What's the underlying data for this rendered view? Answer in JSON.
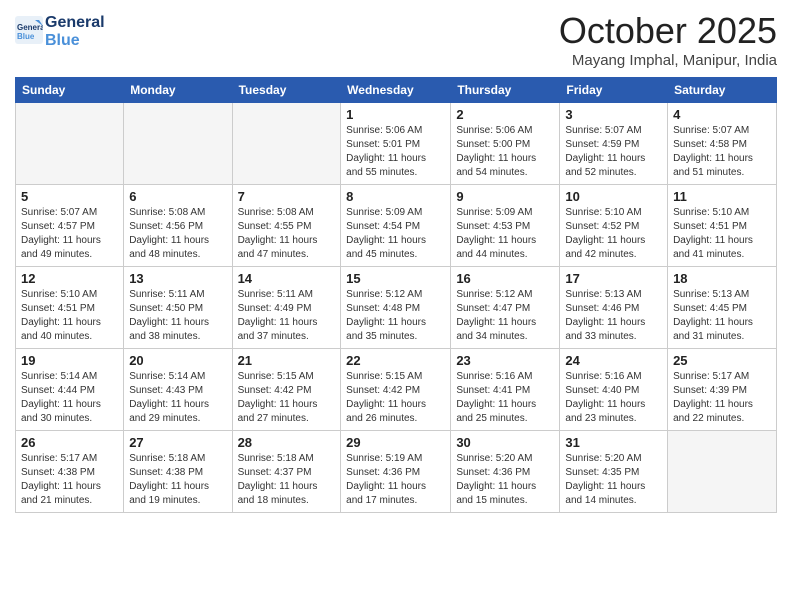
{
  "logo": {
    "line1": "General",
    "line2": "Blue"
  },
  "title": "October 2025",
  "location": "Mayang Imphal, Manipur, India",
  "weekdays": [
    "Sunday",
    "Monday",
    "Tuesday",
    "Wednesday",
    "Thursday",
    "Friday",
    "Saturday"
  ],
  "weeks": [
    [
      {
        "day": "",
        "info": ""
      },
      {
        "day": "",
        "info": ""
      },
      {
        "day": "",
        "info": ""
      },
      {
        "day": "1",
        "info": "Sunrise: 5:06 AM\nSunset: 5:01 PM\nDaylight: 11 hours\nand 55 minutes."
      },
      {
        "day": "2",
        "info": "Sunrise: 5:06 AM\nSunset: 5:00 PM\nDaylight: 11 hours\nand 54 minutes."
      },
      {
        "day": "3",
        "info": "Sunrise: 5:07 AM\nSunset: 4:59 PM\nDaylight: 11 hours\nand 52 minutes."
      },
      {
        "day": "4",
        "info": "Sunrise: 5:07 AM\nSunset: 4:58 PM\nDaylight: 11 hours\nand 51 minutes."
      }
    ],
    [
      {
        "day": "5",
        "info": "Sunrise: 5:07 AM\nSunset: 4:57 PM\nDaylight: 11 hours\nand 49 minutes."
      },
      {
        "day": "6",
        "info": "Sunrise: 5:08 AM\nSunset: 4:56 PM\nDaylight: 11 hours\nand 48 minutes."
      },
      {
        "day": "7",
        "info": "Sunrise: 5:08 AM\nSunset: 4:55 PM\nDaylight: 11 hours\nand 47 minutes."
      },
      {
        "day": "8",
        "info": "Sunrise: 5:09 AM\nSunset: 4:54 PM\nDaylight: 11 hours\nand 45 minutes."
      },
      {
        "day": "9",
        "info": "Sunrise: 5:09 AM\nSunset: 4:53 PM\nDaylight: 11 hours\nand 44 minutes."
      },
      {
        "day": "10",
        "info": "Sunrise: 5:10 AM\nSunset: 4:52 PM\nDaylight: 11 hours\nand 42 minutes."
      },
      {
        "day": "11",
        "info": "Sunrise: 5:10 AM\nSunset: 4:51 PM\nDaylight: 11 hours\nand 41 minutes."
      }
    ],
    [
      {
        "day": "12",
        "info": "Sunrise: 5:10 AM\nSunset: 4:51 PM\nDaylight: 11 hours\nand 40 minutes."
      },
      {
        "day": "13",
        "info": "Sunrise: 5:11 AM\nSunset: 4:50 PM\nDaylight: 11 hours\nand 38 minutes."
      },
      {
        "day": "14",
        "info": "Sunrise: 5:11 AM\nSunset: 4:49 PM\nDaylight: 11 hours\nand 37 minutes."
      },
      {
        "day": "15",
        "info": "Sunrise: 5:12 AM\nSunset: 4:48 PM\nDaylight: 11 hours\nand 35 minutes."
      },
      {
        "day": "16",
        "info": "Sunrise: 5:12 AM\nSunset: 4:47 PM\nDaylight: 11 hours\nand 34 minutes."
      },
      {
        "day": "17",
        "info": "Sunrise: 5:13 AM\nSunset: 4:46 PM\nDaylight: 11 hours\nand 33 minutes."
      },
      {
        "day": "18",
        "info": "Sunrise: 5:13 AM\nSunset: 4:45 PM\nDaylight: 11 hours\nand 31 minutes."
      }
    ],
    [
      {
        "day": "19",
        "info": "Sunrise: 5:14 AM\nSunset: 4:44 PM\nDaylight: 11 hours\nand 30 minutes."
      },
      {
        "day": "20",
        "info": "Sunrise: 5:14 AM\nSunset: 4:43 PM\nDaylight: 11 hours\nand 29 minutes."
      },
      {
        "day": "21",
        "info": "Sunrise: 5:15 AM\nSunset: 4:42 PM\nDaylight: 11 hours\nand 27 minutes."
      },
      {
        "day": "22",
        "info": "Sunrise: 5:15 AM\nSunset: 4:42 PM\nDaylight: 11 hours\nand 26 minutes."
      },
      {
        "day": "23",
        "info": "Sunrise: 5:16 AM\nSunset: 4:41 PM\nDaylight: 11 hours\nand 25 minutes."
      },
      {
        "day": "24",
        "info": "Sunrise: 5:16 AM\nSunset: 4:40 PM\nDaylight: 11 hours\nand 23 minutes."
      },
      {
        "day": "25",
        "info": "Sunrise: 5:17 AM\nSunset: 4:39 PM\nDaylight: 11 hours\nand 22 minutes."
      }
    ],
    [
      {
        "day": "26",
        "info": "Sunrise: 5:17 AM\nSunset: 4:38 PM\nDaylight: 11 hours\nand 21 minutes."
      },
      {
        "day": "27",
        "info": "Sunrise: 5:18 AM\nSunset: 4:38 PM\nDaylight: 11 hours\nand 19 minutes."
      },
      {
        "day": "28",
        "info": "Sunrise: 5:18 AM\nSunset: 4:37 PM\nDaylight: 11 hours\nand 18 minutes."
      },
      {
        "day": "29",
        "info": "Sunrise: 5:19 AM\nSunset: 4:36 PM\nDaylight: 11 hours\nand 17 minutes."
      },
      {
        "day": "30",
        "info": "Sunrise: 5:20 AM\nSunset: 4:36 PM\nDaylight: 11 hours\nand 15 minutes."
      },
      {
        "day": "31",
        "info": "Sunrise: 5:20 AM\nSunset: 4:35 PM\nDaylight: 11 hours\nand 14 minutes."
      },
      {
        "day": "",
        "info": ""
      }
    ]
  ]
}
